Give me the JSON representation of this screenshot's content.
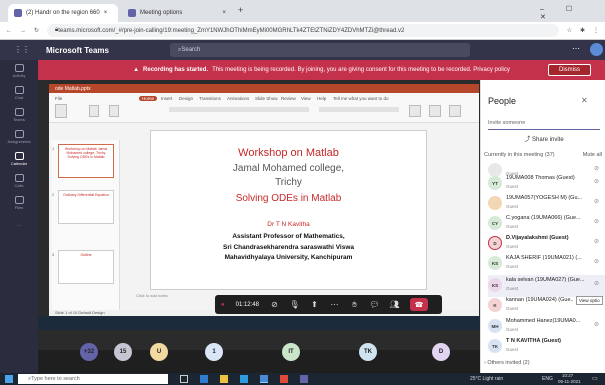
{
  "browser": {
    "tab1": "(2) Handr on the region 660",
    "tab2": "Meeting options",
    "url": "teams.microsoft.com/_#/pre-join-calling/19:meeting_ZmY1NWJhOThiMmEyMi00MGRhLTk4ZTEtZTNiZDY4ZDVhMTZi@thread.v2"
  },
  "teams": {
    "app_name": "Microsoft Teams",
    "search_placeholder": "Search",
    "rail": [
      "Activity",
      "Chat",
      "Teams",
      "Assignments",
      "Calendar",
      "Calls",
      "Files"
    ]
  },
  "banner": {
    "bold": "Recording has started.",
    "text": "This meeting is being recorded. By joining, you are giving consent for this meeting to be recorded. Privacy policy",
    "dismiss": "Dismiss"
  },
  "ppt": {
    "file": "ode Matlab.pptx",
    "ribbon": [
      "File",
      "Home",
      "Insert",
      "Design",
      "Transitions",
      "Animations",
      "Slide Show",
      "Review",
      "View",
      "Help",
      "Tell me what you want to do"
    ],
    "thumbs": [
      {
        "num": "1",
        "text": "Workshop on Matlab Jamal Mohamed college, Trichy Solving ODEs in Matlab"
      },
      {
        "num": "2",
        "text": "Ordinary Differential Equation"
      },
      {
        "num": "3",
        "text": "Outline"
      }
    ],
    "notes": "Click to add notes",
    "status": "Slide 1 of 10   Default Design"
  },
  "slide": {
    "line1": "Workshop on Matlab",
    "line2": "Jamal Mohamed college,",
    "line3": "Trichy",
    "line4": "Solving ODEs  in Matlab",
    "name": "Dr T N Kavitha",
    "role": "Assistant Professor of Mathematics,",
    "org1": "Sri Chandrasekharendra saraswathi Viswa",
    "org2": "Mahavidhyalaya University, Kanchipuram"
  },
  "controls": {
    "timer": "01:12:48"
  },
  "avatars": [
    {
      "label": "+32",
      "color": "#6264a7"
    },
    {
      "label": "15",
      "color": "#c5c5d3"
    },
    {
      "label": "U",
      "color": "#f1d9a0"
    },
    {
      "label": "1",
      "color": "#d8e6f5"
    },
    {
      "label": "IT",
      "color": "#c9e6c9"
    },
    {
      "label": "TK",
      "color": "#cfe3f0"
    },
    {
      "label": "D",
      "color": "#e0d4f0"
    }
  ],
  "people": {
    "title": "People",
    "invite_placeholder": "Invite someone",
    "share": "Share invite",
    "current": "Currently in this meeting (37)",
    "mute_all": "Mute all",
    "list": [
      {
        "initials": "",
        "name": "",
        "role": "Guest",
        "color": "#e8e8e8"
      },
      {
        "initials": "YT",
        "name": "19UMA008 Thomas (Guest)",
        "role": "Guest",
        "color": "#d7ead7"
      },
      {
        "initials": "",
        "name": "19UMA057(YOGESH M) (Gu...",
        "role": "Guest",
        "color": "#f3d7b5"
      },
      {
        "initials": "CY",
        "name": "C.yogana (19UMA066) (Gue...",
        "role": "Guest",
        "color": "#d7ead7"
      },
      {
        "initials": "D",
        "name": "D.Vijayalakshmi (Guest)",
        "role": "Guest",
        "color": "#f3d3d3"
      },
      {
        "initials": "KS",
        "name": "KAJA SHERIF (19UMA021) (...",
        "role": "Guest",
        "color": "#d7ead7"
      },
      {
        "initials": "KS",
        "name": "kala selvan (19UMA027) (Gue...",
        "role": "Guest",
        "color": "#ead7ea"
      },
      {
        "initials": "K",
        "name": "kannan (19UMA024) (Gue...",
        "role": "Guest",
        "color": "#f3d3d3"
      },
      {
        "initials": "MH",
        "name": "Mohammed Hanez(19UMA0...",
        "role": "Guest",
        "color": "#d7e3f3"
      },
      {
        "initials": "TK",
        "name": "T N KAVITHA (Guest)",
        "role": "Guest",
        "color": "#d7e3f3"
      }
    ],
    "view_option": "View optio",
    "others": "Others invited (2)"
  },
  "taskbar": {
    "search": "Type here to search",
    "weather": "25°C  Light rain",
    "time": "10:27",
    "date": "05-11-2021",
    "lang": "ENG"
  }
}
